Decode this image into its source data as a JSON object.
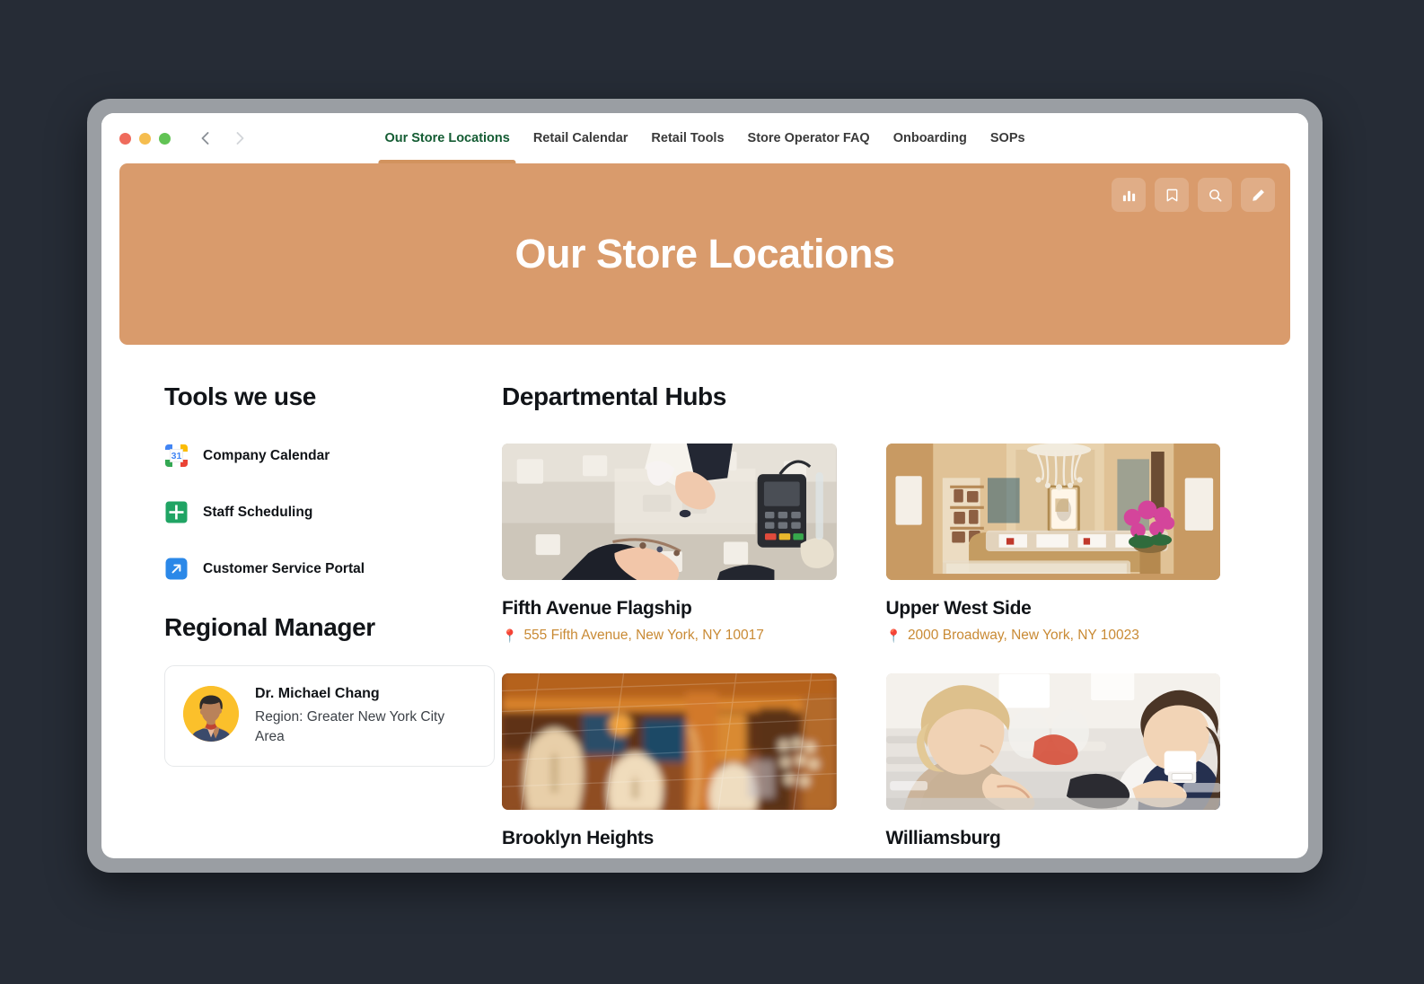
{
  "window": {
    "traffic_lights": [
      "close",
      "minimize",
      "maximize"
    ],
    "back_label": "Back",
    "forward_label": "Forward"
  },
  "nav": {
    "tabs": [
      {
        "label": "Our Store Locations",
        "active": true
      },
      {
        "label": "Retail Calendar",
        "active": false
      },
      {
        "label": "Retail Tools",
        "active": false
      },
      {
        "label": "Store Operator FAQ",
        "active": false
      },
      {
        "label": "Onboarding",
        "active": false
      },
      {
        "label": "SOPs",
        "active": false
      }
    ],
    "active_color": "#145c33",
    "underline_color": "#d2935e"
  },
  "hero": {
    "title": "Our Store Locations",
    "background_color": "#d99b6c",
    "actions": [
      {
        "icon": "bar-chart-icon",
        "name": "analytics-button"
      },
      {
        "icon": "bookmark-icon",
        "name": "bookmark-button"
      },
      {
        "icon": "search-icon",
        "name": "search-button"
      },
      {
        "icon": "pencil-icon",
        "name": "edit-button"
      }
    ]
  },
  "sidebar": {
    "tools_title": "Tools we use",
    "tools": [
      {
        "label": "Company Calendar",
        "icon": "google-calendar-icon",
        "badge": "31"
      },
      {
        "label": "Staff Scheduling",
        "icon": "google-sheets-icon"
      },
      {
        "label": "Customer Service Portal",
        "icon": "external-link-icon"
      }
    ],
    "manager_title": "Regional Manager",
    "manager": {
      "name": "Dr. Michael Chang",
      "region": "Region: Greater New York City Area",
      "avatar_background": "#fbc02b"
    }
  },
  "main": {
    "hubs_title": "Departmental Hubs",
    "address_color": "#c98a34",
    "hubs": [
      {
        "name": "Fifth Avenue Flagship",
        "address": "555 Fifth Avenue, New York, NY 10017",
        "pin": "📍",
        "image": "jewelry-counter-transaction-photo"
      },
      {
        "name": "Upper West Side",
        "address": "2000 Broadway, New York, NY 10023",
        "pin": "📍",
        "image": "luxury-boutique-interior-photo"
      },
      {
        "name": "Brooklyn Heights",
        "address": "",
        "pin": "",
        "image": "jewelry-window-display-photo"
      },
      {
        "name": "Williamsburg",
        "address": "",
        "pin": "",
        "image": "customer-with-associate-photo"
      }
    ]
  }
}
